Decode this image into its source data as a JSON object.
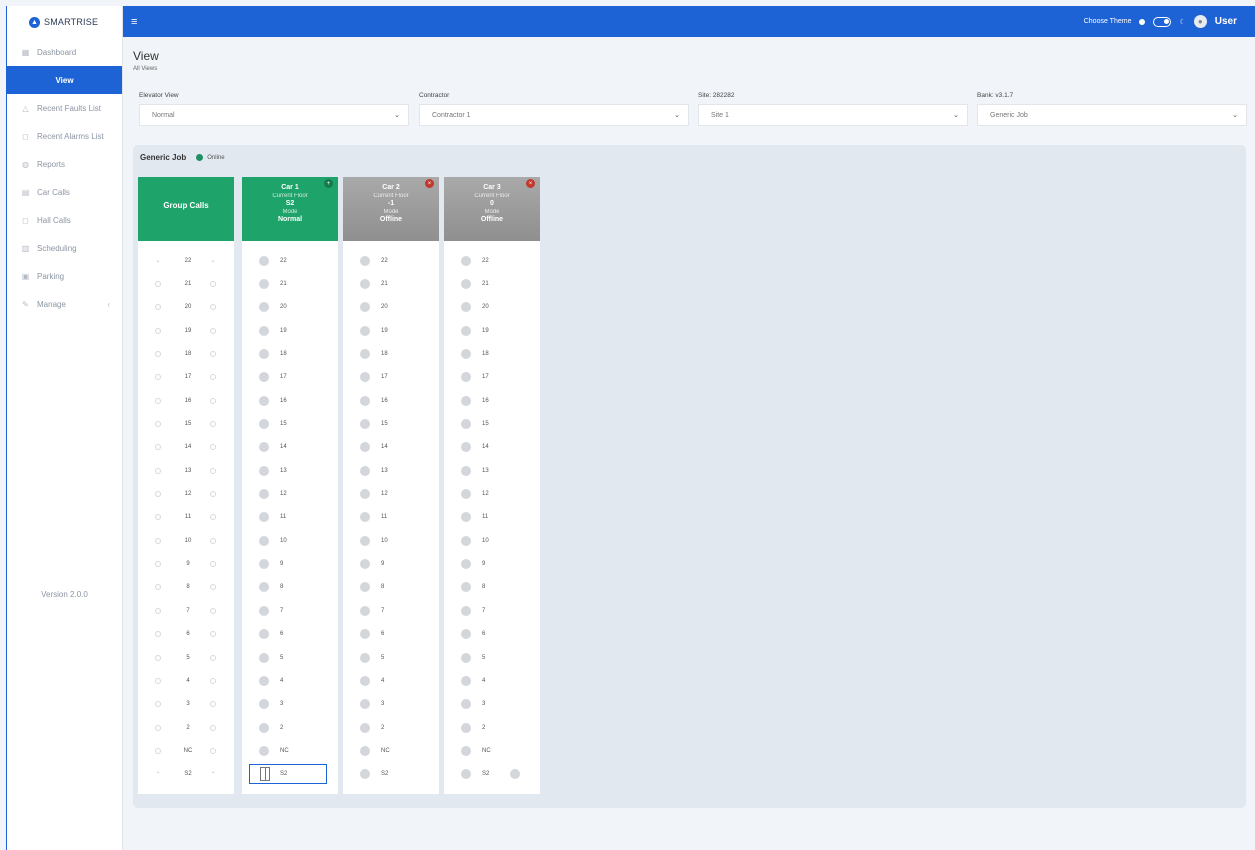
{
  "app": {
    "logo_text": "SMARTRISE"
  },
  "sidebar": {
    "items": [
      {
        "label": "Dashboard",
        "icon": "dashboard-icon",
        "active": false
      },
      {
        "label": "View",
        "icon": "",
        "active": true
      },
      {
        "label": "Recent Faults List",
        "icon": "warning-icon",
        "active": false
      },
      {
        "label": "Recent Alarms List",
        "icon": "bell-icon",
        "active": false
      },
      {
        "label": "Reports",
        "icon": "report-icon",
        "active": false
      },
      {
        "label": "Car Calls",
        "icon": "car-calls-icon",
        "active": false
      },
      {
        "label": "Hall Calls",
        "icon": "hall-calls-icon",
        "active": false
      },
      {
        "label": "Scheduling",
        "icon": "calendar-icon",
        "active": false
      },
      {
        "label": "Parking",
        "icon": "parking-icon",
        "active": false
      },
      {
        "label": "Manage",
        "icon": "wrench-icon",
        "active": false,
        "expandable": true
      }
    ],
    "version": "Version 2.0.0"
  },
  "topbar": {
    "theme_label": "Choose Theme",
    "user": "User"
  },
  "page": {
    "title": "View",
    "subtitle": "All Views"
  },
  "filters": [
    {
      "label": "Elevator View",
      "value": "Normal"
    },
    {
      "label": "Contractor",
      "value": "Contractor 1"
    },
    {
      "label": "Site: 282282",
      "value": "Site 1"
    },
    {
      "label": "Bank: v3.1.7",
      "value": "Generic Job"
    }
  ],
  "job": {
    "name": "Generic Job",
    "status": "Online",
    "status_color": "#1f8f63"
  },
  "group_calls": {
    "title": "Group Calls"
  },
  "floors": [
    "22",
    "21",
    "20",
    "19",
    "18",
    "17",
    "16",
    "15",
    "14",
    "13",
    "12",
    "11",
    "10",
    "9",
    "8",
    "7",
    "6",
    "5",
    "4",
    "3",
    "2",
    "NC",
    "S2"
  ],
  "cars": [
    {
      "title": "Car 1",
      "floor_label": "Current Floor",
      "floor": "S2",
      "mode_label": "Mode",
      "mode": "Normal",
      "status": "online",
      "color": "#1ea36a"
    },
    {
      "title": "Car 2",
      "floor_label": "Current Floor",
      "floor": "-1",
      "mode_label": "Mode",
      "mode": "Offline",
      "status": "offline",
      "color": "#9a9a9a"
    },
    {
      "title": "Car 3",
      "floor_label": "Current Floor",
      "floor": "0",
      "mode_label": "Mode",
      "mode": "Offline",
      "status": "offline",
      "color": "#9a9a9a"
    }
  ],
  "colors": {
    "primary": "#1e63d5",
    "online": "#1ea36a",
    "offline": "#9a9a9a",
    "error": "#c0392b"
  }
}
